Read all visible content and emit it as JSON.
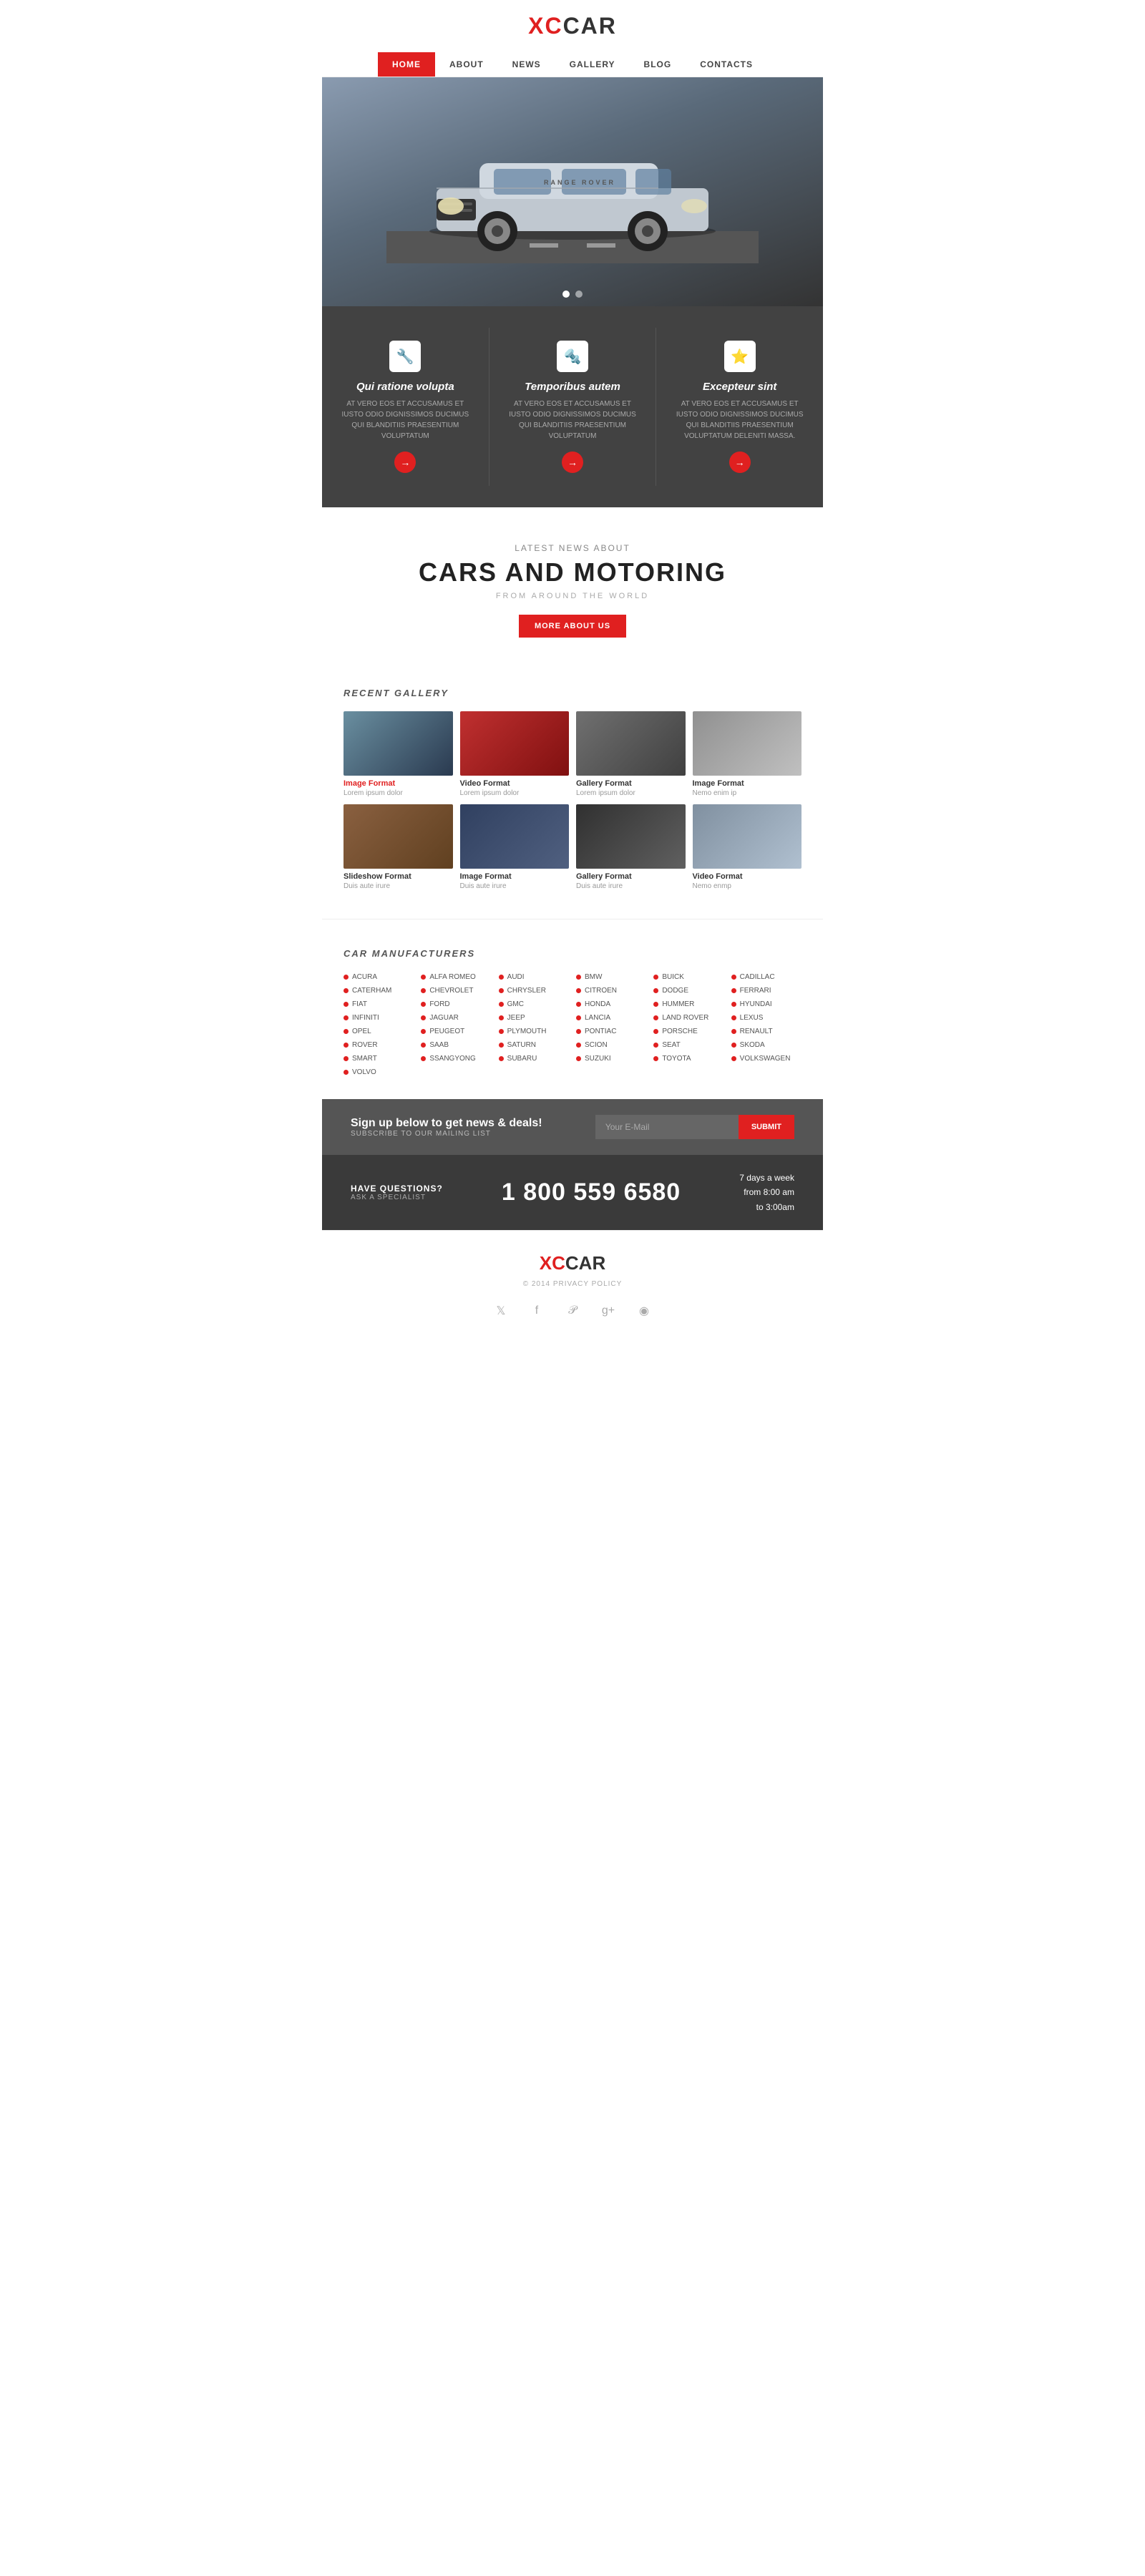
{
  "header": {
    "logo_xc": "XC",
    "logo_car": "CAR"
  },
  "nav": {
    "items": [
      {
        "label": "HOME",
        "active": true
      },
      {
        "label": "ABOUT",
        "active": false
      },
      {
        "label": "NEWS",
        "active": false
      },
      {
        "label": "GALLERY",
        "active": false
      },
      {
        "label": "BLOG",
        "active": false
      },
      {
        "label": "CONTACTS",
        "active": false
      }
    ]
  },
  "features": [
    {
      "icon": "🔧",
      "title": "Qui ratione volupta",
      "description": "AT VERO EOS ET ACCUSAMUS ET IUSTO ODIO DIGNISSIMOS DUCIMUS QUI BLANDITIIS PRAESENTIUM VOLUPTATUM",
      "btn": "→"
    },
    {
      "icon": "🔩",
      "title": "Temporibus autem",
      "description": "AT VERO EOS ET ACCUSAMUS ET IUSTO ODIO DIGNISSIMOS DUCIMUS QUI BLANDITIIS PRAESENTIUM VOLUPTATUM",
      "btn": "→"
    },
    {
      "icon": "⭐",
      "title": "Excepteur sint",
      "description": "AT VERO EOS ET ACCUSAMUS ET IUSTO ODIO DIGNISSIMOS DUCIMUS QUI BLANDITIIS PRAESENTIUM VOLUPTATUM DELENITI MASSA.",
      "btn": "→"
    }
  ],
  "news": {
    "subtitle": "LATEST NEWS ABOUT",
    "title": "CARS AND MOTORING",
    "tagline": "FROM AROUND THE WORLD",
    "more_btn": "MORE ABOUT US"
  },
  "gallery": {
    "label": "RECENT GALLERY",
    "items": [
      {
        "title": "Image Format",
        "desc": "Lorem ipsum dolor",
        "red": true,
        "color": "gt1"
      },
      {
        "title": "Video Format",
        "desc": "Lorem ipsum dolor",
        "red": false,
        "color": "gt2"
      },
      {
        "title": "Gallery Format",
        "desc": "Lorem ipsum dolor",
        "red": false,
        "color": "gt3"
      },
      {
        "title": "Image Format",
        "desc": "Nemo enim ip",
        "red": false,
        "color": "gt4"
      },
      {
        "title": "Slideshow Format",
        "desc": "Duis aute irure",
        "red": false,
        "color": "gt5"
      },
      {
        "title": "Image Format",
        "desc": "Duis aute irure",
        "red": false,
        "color": "gt6"
      },
      {
        "title": "Gallery Format",
        "desc": "Duis aute irure",
        "red": false,
        "color": "gt7"
      },
      {
        "title": "Video Format",
        "desc": "Nemo enmp",
        "red": false,
        "color": "gt8"
      }
    ]
  },
  "manufacturers": {
    "label": "CAR MANUFACTURERS",
    "items": [
      "ACURA",
      "ALFA ROMEO",
      "AUDI",
      "BMW",
      "BUICK",
      "CADILLAC",
      "CATERHAM",
      "CHEVROLET",
      "CHRYSLER",
      "CITROEN",
      "DODGE",
      "FERRARI",
      "FIAT",
      "FORD",
      "GMC",
      "HONDA",
      "HUMMER",
      "HYUNDAI",
      "INFINITI",
      "JAGUAR",
      "JEEP",
      "LANCIA",
      "LAND ROVER",
      "LEXUS",
      "OPEL",
      "PEUGEOT",
      "PLYMOUTH",
      "PONTIAC",
      "PORSCHE",
      "RENAULT",
      "ROVER",
      "SAAB",
      "SATURN",
      "SCION",
      "SEAT",
      "SKODA",
      "SMART",
      "SSANGYONG",
      "SUBARU",
      "SUZUKI",
      "TOYOTA",
      "VOLKSWAGEN",
      "VOLVO"
    ]
  },
  "newsletter": {
    "title": "Sign up below to get news & deals!",
    "subtitle": "SUBSCRIBE TO OUR MAILING LIST",
    "placeholder": "Your E-Mail",
    "btn": "submit"
  },
  "contact": {
    "label1": "HAVE QUESTIONS?",
    "label2": "ASK A SPECIALIST",
    "phone": "1 800 559 6580",
    "hours1": "7 days a week",
    "hours2": "from 8:00 am",
    "hours3": "to 3:00am"
  },
  "footer": {
    "logo_xc": "XC",
    "logo_car": "CAR",
    "copy": "© 2014  PRIVACY POLICY",
    "social": [
      "twitter",
      "facebook",
      "pinterest",
      "google-plus",
      "github"
    ]
  }
}
